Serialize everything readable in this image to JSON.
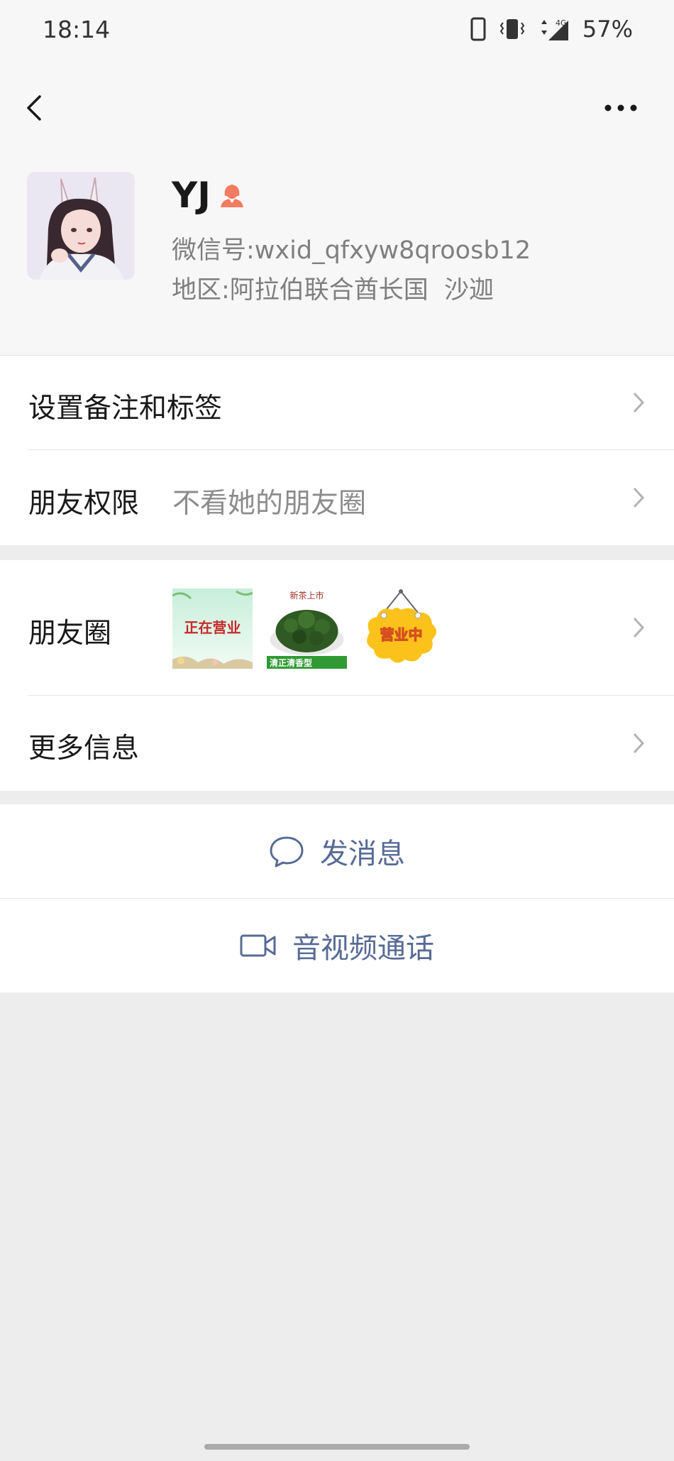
{
  "status_bar": {
    "time": "18:14",
    "network": "4G",
    "battery": "57%"
  },
  "profile": {
    "name": "YJ",
    "wxid_label": "微信号:",
    "wxid": "wxid_qfxyw8qroosb12",
    "region_label": "地区:",
    "region": "阿拉伯联合酋长国  沙迦"
  },
  "settings": {
    "remark_label": "设置备注和标签",
    "permission_label": "朋友权限",
    "permission_value": "不看她的朋友圈"
  },
  "moments": {
    "label": "朋友圈",
    "thumbs": [
      {
        "text": "正在营业"
      },
      {
        "top_text": "新茶上市",
        "bottom_text": "清正清香型"
      },
      {
        "text": "营业中"
      }
    ]
  },
  "more_info": {
    "label": "更多信息"
  },
  "actions": {
    "message": "发消息",
    "call": "音视频通话"
  },
  "colors": {
    "link": "#576b95",
    "background": "#ededed",
    "gender_icon": "#f37b62"
  }
}
